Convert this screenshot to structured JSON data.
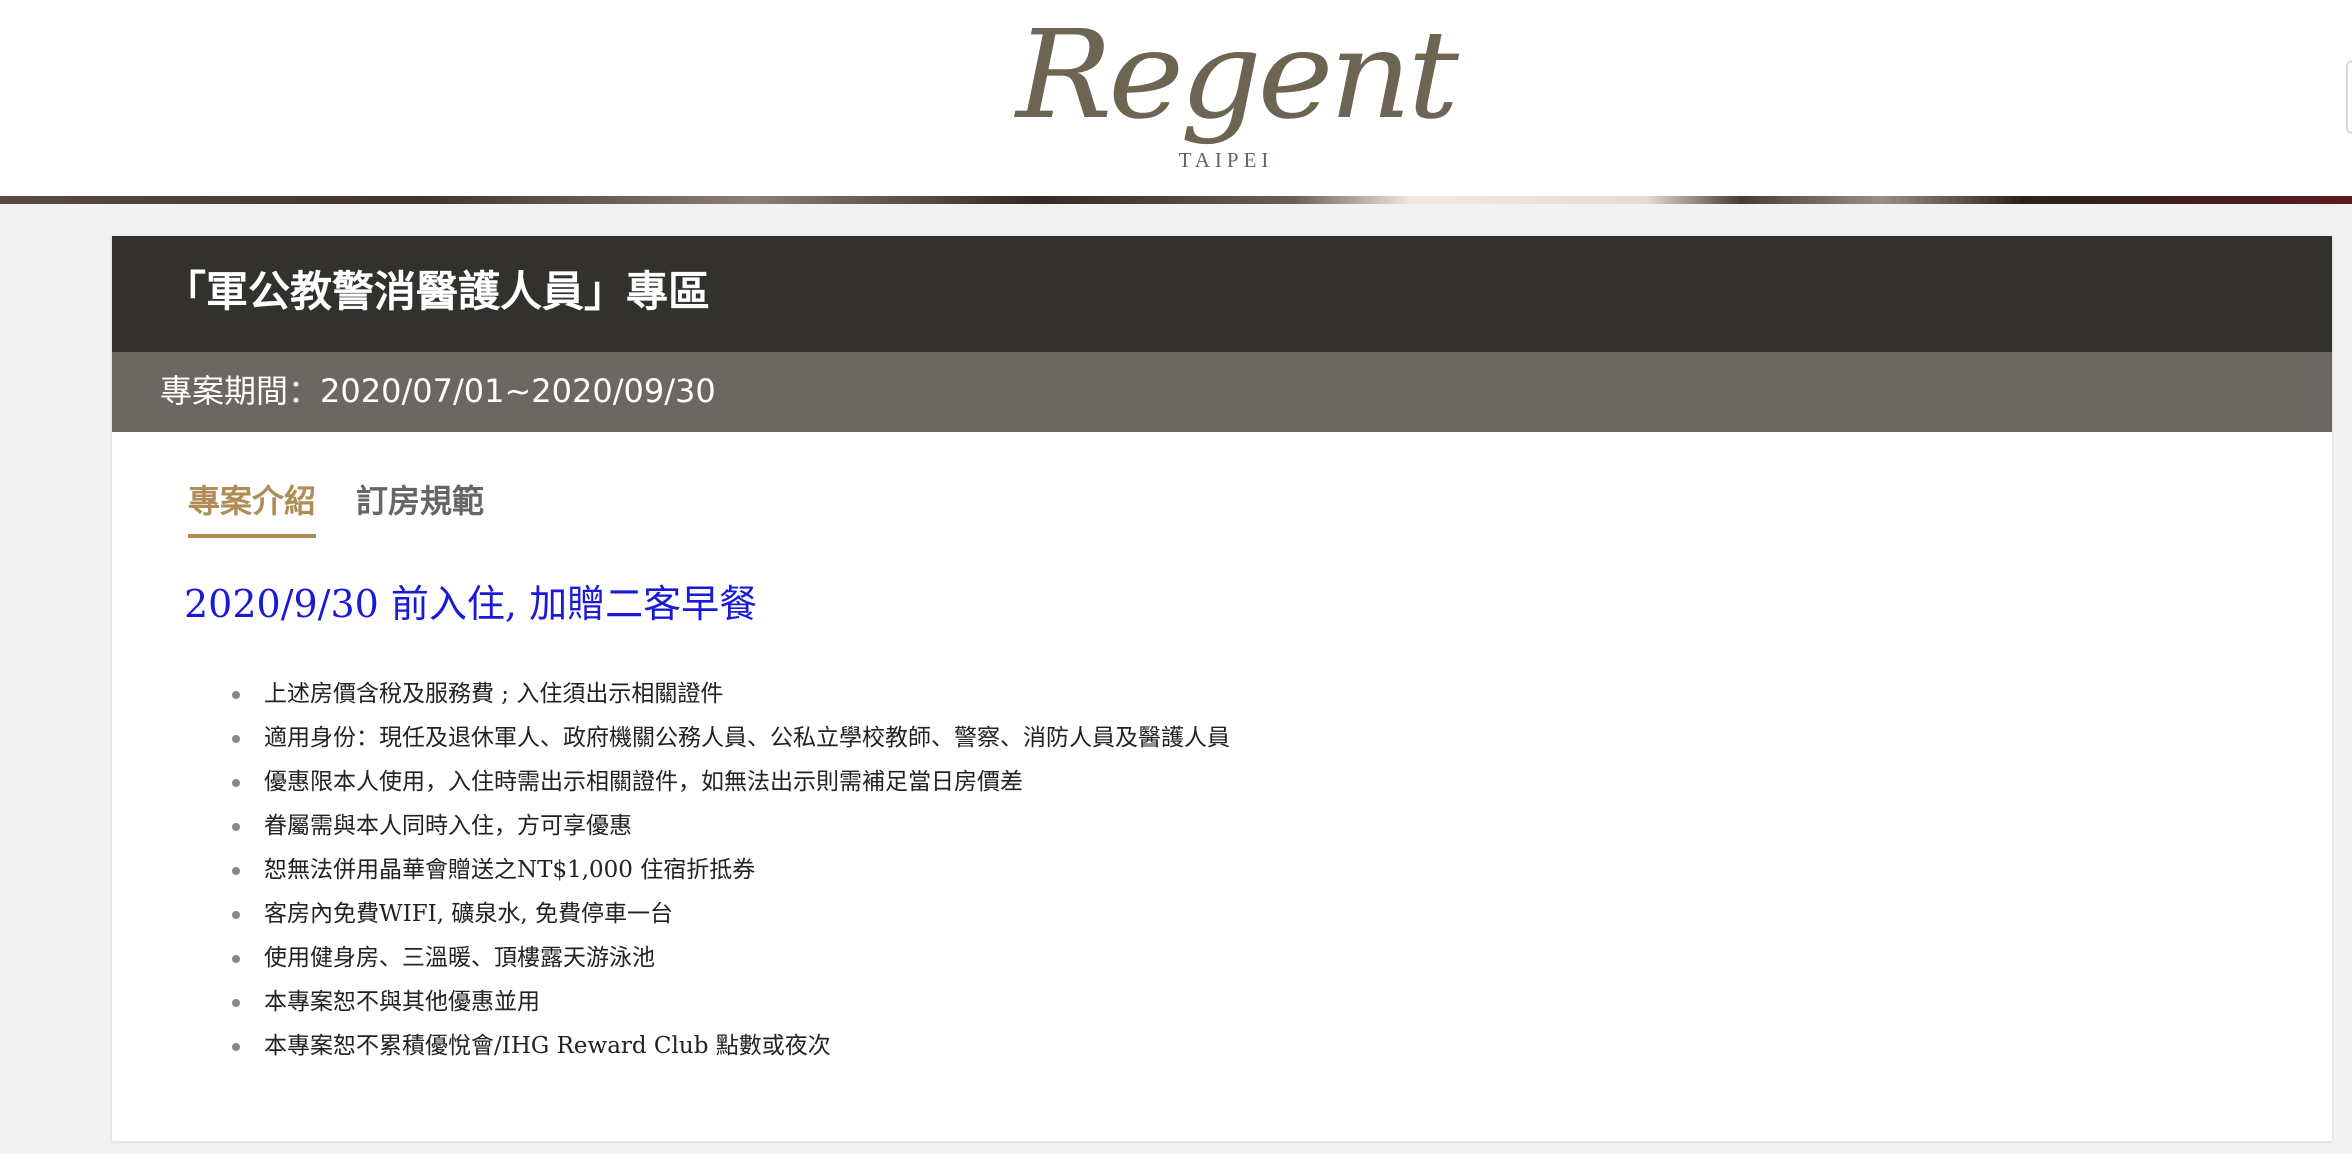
{
  "header": {
    "logo": {
      "script": "Regent",
      "sub": "TAIPEI"
    }
  },
  "card": {
    "title": "「軍公教警消醫護人員」專區",
    "period": "專案期間：2020/07/01~2020/09/30",
    "tabs": [
      {
        "label": "專案介紹",
        "active": true
      },
      {
        "label": "訂房規範",
        "active": false
      }
    ],
    "headline": "2020/9/30 前入住, 加贈二客早餐",
    "bullets": [
      "上述房價含稅及服務費 ; 入住須出示相關證件",
      "適用身份：現任及退休軍人、政府機關公務人員、公私立學校教師、警察、消防人員及醫護人員",
      "優惠限本人使用，入住時需出示相關證件，如無法出示則需補足當日房價差",
      "眷屬需與本人同時入住，方可享優惠",
      "恕無法併用晶華會贈送之NT$1,000 住宿折抵券",
      "客房內免費WIFI, 礦泉水, 免費停車一台",
      "使用健身房、三溫暖、頂樓露天游泳池",
      "本專案恕不與其他優惠並用",
      "本專案恕不累積優悅會/IHG Reward Club 點數或夜次"
    ]
  },
  "colors": {
    "title_bar": "#33312e",
    "period_bar": "#6b6762",
    "accent": "#b08d57",
    "headline": "#1a1ad6",
    "logo": "#6e6452"
  }
}
